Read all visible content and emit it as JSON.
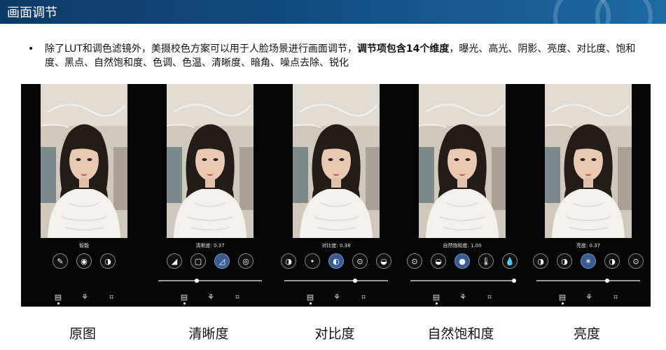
{
  "header": {
    "title": "画面调节"
  },
  "bullet": {
    "marker": "•",
    "text_before": "除了LUT和调色滤镜外，美摄校色方案可以用于人脸场景进行画面调节，",
    "text_bold": "调节项包含14个维度",
    "text_after": "，曝光、高光、阴影、亮度、对比度、饱和度、黑点、自然饱和度、色调、色温、清晰度、暗角、噪点去除、锐化"
  },
  "panels": [
    {
      "param_label": "智能",
      "caption": "原图",
      "icons": [
        "magic-wand-icon",
        "circle-dot-icon",
        "half-circle-icon"
      ],
      "selected_icon": -1,
      "slider": null
    },
    {
      "param_label": "清晰度: 0.37",
      "caption": "清晰度",
      "icons": [
        "triangle-icon",
        "square-icon",
        "sharpness-icon",
        "vignette-icon"
      ],
      "selected_icon": 2,
      "slider": 0.37
    },
    {
      "param_label": "对比度: 0.38",
      "caption": "对比度",
      "icons": [
        "half-circle-icon",
        "dot-icon",
        "contrast-icon",
        "target-icon",
        "color-circle-icon"
      ],
      "selected_icon": 2,
      "slider": 0.68
    },
    {
      "param_label": "自然饱和度: 1.00",
      "caption": "自然饱和度",
      "icons": [
        "target-icon",
        "color-circle-icon",
        "vibrance-icon",
        "thermometer-icon",
        "drop-icon"
      ],
      "selected_icon": 2,
      "slider": 1.0
    },
    {
      "param_label": "亮度: 0.37",
      "caption": "亮度",
      "icons": [
        "half-circle-icon",
        "half-circle-icon",
        "sun-dot-icon",
        "half-circle-icon",
        "target-icon"
      ],
      "selected_icon": 2,
      "slider": 0.68
    }
  ],
  "bottom_tabs": [
    "adjust-icon",
    "filter-icon",
    "crop-icon"
  ],
  "colors": {
    "header_start": "#0d3a67",
    "header_end": "#1d6aa5",
    "selected": "#3b5c92"
  }
}
